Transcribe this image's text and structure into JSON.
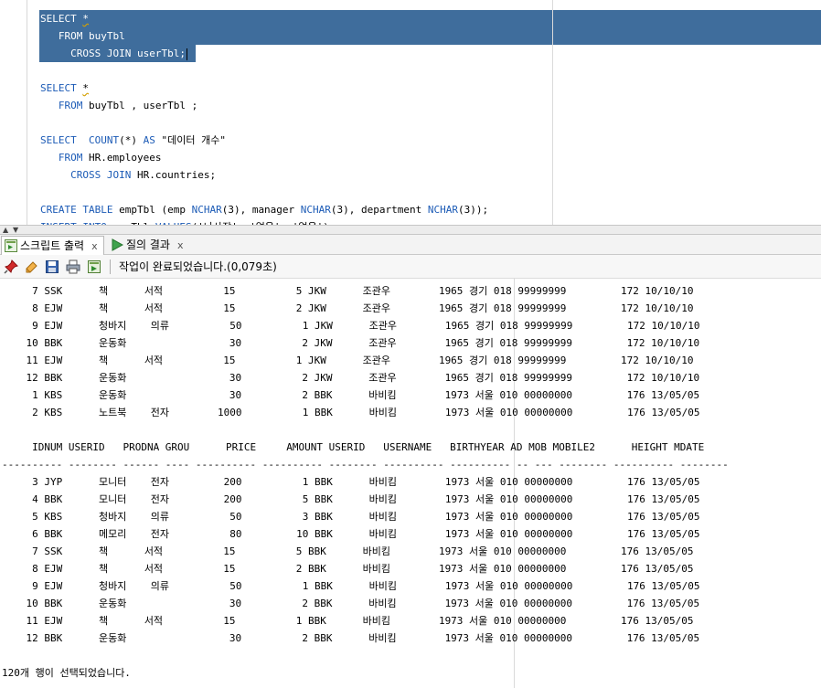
{
  "editor": {
    "lines": [
      {
        "segments": [
          {
            "t": "SELECT ",
            "k": true
          },
          {
            "t": "*",
            "s": true
          }
        ],
        "selected": true
      },
      {
        "segments": [
          {
            "t": "   "
          },
          {
            "t": "FROM",
            "k": true
          },
          {
            "t": " buyTbl"
          }
        ],
        "selected": true
      },
      {
        "segments": [
          {
            "t": "     "
          },
          {
            "t": "CROSS JOIN",
            "k": true
          },
          {
            "t": " userTbl;"
          }
        ],
        "selected": true,
        "caret": true
      },
      {
        "segments": []
      },
      {
        "segments": [
          {
            "t": "SELECT ",
            "k": true
          },
          {
            "t": "*",
            "s": true
          }
        ]
      },
      {
        "segments": [
          {
            "t": "   "
          },
          {
            "t": "FROM",
            "k": true
          },
          {
            "t": " buyTbl , userTbl ;"
          }
        ]
      },
      {
        "segments": []
      },
      {
        "segments": [
          {
            "t": "SELECT  ",
            "k": true
          },
          {
            "t": "COUNT",
            "k": true
          },
          {
            "t": "(*) "
          },
          {
            "t": "AS",
            "k": true
          },
          {
            "t": " \"데이터 개수\""
          }
        ]
      },
      {
        "segments": [
          {
            "t": "   "
          },
          {
            "t": "FROM",
            "k": true
          },
          {
            "t": " HR.employees"
          }
        ]
      },
      {
        "segments": [
          {
            "t": "     "
          },
          {
            "t": "CROSS JOIN",
            "k": true
          },
          {
            "t": " HR.countries;"
          }
        ]
      },
      {
        "segments": []
      },
      {
        "segments": [
          {
            "t": "CREATE TABLE",
            "k": true
          },
          {
            "t": " empTbl (emp "
          },
          {
            "t": "NCHAR",
            "k": true
          },
          {
            "t": "(3), manager "
          },
          {
            "t": "NCHAR",
            "k": true
          },
          {
            "t": "(3), department "
          },
          {
            "t": "NCHAR",
            "k": true
          },
          {
            "t": "(3));"
          }
        ]
      },
      {
        "segments": [
          {
            "t": "INSERT INTO",
            "k": true
          },
          {
            "t": " empTbl "
          },
          {
            "t": "VALUES",
            "k": true
          },
          {
            "t": "('나사장', '없음', '없음');"
          }
        ]
      }
    ]
  },
  "tabs": [
    {
      "label": "스크립트 출력",
      "close": "x",
      "active": true,
      "icon": "script-output-icon"
    },
    {
      "label": "질의 결과",
      "close": "x",
      "active": false,
      "icon": "run-query-icon"
    }
  ],
  "toolbar": {
    "icons": [
      "pin-icon",
      "eraser-icon",
      "save-icon",
      "print-icon",
      "export-icon"
    ],
    "status": "작업이 완료되었습니다.(0,079초)"
  },
  "output": {
    "lines": [
      "     7 SSK      책      서적          15          5 JKW      조관우        1965 경기 018 99999999         172 10/10/10",
      "     8 EJW      책      서적          15          2 JKW      조관우        1965 경기 018 99999999         172 10/10/10",
      "     9 EJW      청바지    의류          50          1 JKW      조관우        1965 경기 018 99999999         172 10/10/10",
      "    10 BBK      운동화                 30          2 JKW      조관우        1965 경기 018 99999999         172 10/10/10",
      "    11 EJW      책      서적          15          1 JKW      조관우        1965 경기 018 99999999         172 10/10/10",
      "    12 BBK      운동화                 30          2 JKW      조관우        1965 경기 018 99999999         172 10/10/10",
      "     1 KBS      운동화                 30          2 BBK      바비킴        1973 서울 010 00000000         176 13/05/05",
      "     2 KBS      노트북    전자        1000          1 BBK      바비킴        1973 서울 010 00000000         176 13/05/05",
      "",
      "     IDNUM USERID   PRODNA GROU      PRICE     AMOUNT USERID   USERNAME   BIRTHYEAR AD MOB MOBILE2      HEIGHT MDATE",
      "---------- -------- ------ ---- ---------- ---------- -------- ---------- ---------- -- --- -------- ---------- --------",
      "     3 JYP      모니터    전자         200          1 BBK      바비킴        1973 서울 010 00000000         176 13/05/05",
      "     4 BBK      모니터    전자         200          5 BBK      바비킴        1973 서울 010 00000000         176 13/05/05",
      "     5 KBS      청바지    의류          50          3 BBK      바비킴        1973 서울 010 00000000         176 13/05/05",
      "     6 BBK      메모리    전자          80         10 BBK      바비킴        1973 서울 010 00000000         176 13/05/05",
      "     7 SSK      책      서적          15          5 BBK      바비킴        1973 서울 010 00000000         176 13/05/05",
      "     8 EJW      책      서적          15          2 BBK      바비킴        1973 서울 010 00000000         176 13/05/05",
      "     9 EJW      청바지    의류          50          1 BBK      바비킴        1973 서울 010 00000000         176 13/05/05",
      "    10 BBK      운동화                 30          2 BBK      바비킴        1973 서울 010 00000000         176 13/05/05",
      "    11 EJW      책      서적          15          1 BBK      바비킴        1973 서울 010 00000000         176 13/05/05",
      "    12 BBK      운동화                 30          2 BBK      바비킴        1973 서울 010 00000000         176 13/05/05",
      "",
      "120개 행이 선택되었습니다."
    ]
  }
}
